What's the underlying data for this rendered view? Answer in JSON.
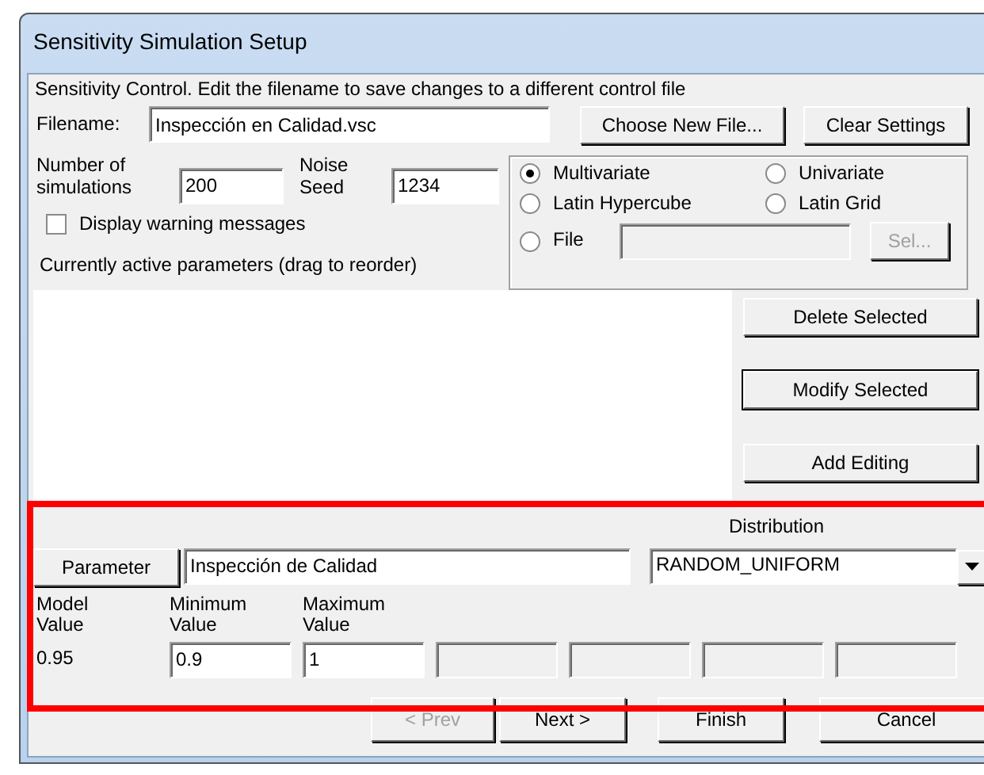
{
  "window": {
    "title": "Sensitivity Simulation Setup"
  },
  "instructions": "Sensitivity Control.  Edit the filename to save changes to a different control file",
  "filename": {
    "label": "Filename:",
    "value": "Inspección en Calidad.vsc"
  },
  "file_buttons": [
    "Choose New File...",
    "Clear Settings"
  ],
  "simulations": {
    "label": "Number of simulations",
    "value": "200"
  },
  "noise_seed": {
    "label": "Noise Seed",
    "value": "1234"
  },
  "methods": [
    {
      "label": "Multivariate",
      "selected": true
    },
    {
      "label": "Univariate",
      "selected": false
    },
    {
      "label": "Latin Hypercube",
      "selected": false
    },
    {
      "label": "Latin Grid",
      "selected": false
    },
    {
      "label": "File",
      "selected": false
    }
  ],
  "file_path": {
    "disabled": true
  },
  "select_button": {
    "label": "Sel...",
    "disabled": true
  },
  "warning_checkbox": {
    "label": "Display warning messages",
    "checked": false
  },
  "active_parameters": {
    "label": "Currently active parameters (drag to reorder)"
  },
  "side_buttons": [
    "Delete Selected",
    "Modify Selected",
    "Add Editing"
  ],
  "distribution": {
    "label": "Distribution",
    "value": "RANDOM_UNIFORM"
  },
  "parameter": {
    "button": "Parameter",
    "value": "Inspección de Calidad"
  },
  "values": [
    {
      "kind": "text",
      "label": "Model Value",
      "value": "0.95"
    },
    {
      "kind": "input",
      "label": "Minimum Value",
      "value": "0.9"
    },
    {
      "kind": "input",
      "label": "Maximum Value",
      "value": "1"
    },
    {
      "kind": "disabled"
    },
    {
      "kind": "disabled"
    },
    {
      "kind": "disabled"
    },
    {
      "kind": "disabled"
    }
  ],
  "nav_buttons": [
    {
      "label": "< Prev",
      "disabled": true
    },
    {
      "label": "Next >",
      "disabled": false
    },
    {
      "label": "Finish",
      "disabled": false
    },
    {
      "label": "Cancel",
      "disabled": false
    }
  ]
}
